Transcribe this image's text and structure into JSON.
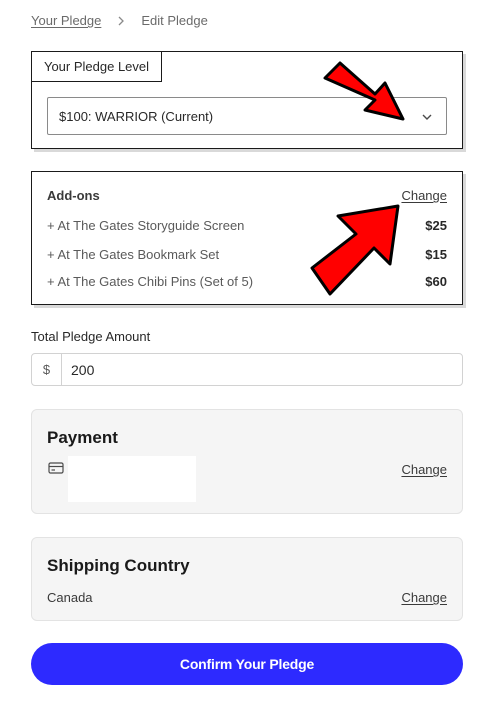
{
  "breadcrumb": {
    "parent": "Your Pledge",
    "current": "Edit Pledge"
  },
  "pledge_level": {
    "tab_label": "Your Pledge Level",
    "selected": "$100: WARRIOR (Current)"
  },
  "addons": {
    "heading": "Add-ons",
    "change_label": "Change",
    "items": [
      {
        "name": "+ At The Gates Storyguide Screen",
        "price": "$25"
      },
      {
        "name": "+ At The Gates Bookmark Set",
        "price": "$15"
      },
      {
        "name": "+ At The Gates Chibi Pins (Set of 5)",
        "price": "$60"
      }
    ]
  },
  "total": {
    "label": "Total Pledge Amount",
    "currency": "$",
    "value": "200"
  },
  "payment": {
    "heading": "Payment",
    "change_label": "Change",
    "icon": "credit-card-icon"
  },
  "shipping": {
    "heading": "Shipping Country",
    "country": "Canada",
    "change_label": "Change"
  },
  "confirm_label": "Confirm Your Pledge",
  "colors": {
    "accent": "#2d2aff",
    "annotation_arrow": "#ff0000"
  }
}
